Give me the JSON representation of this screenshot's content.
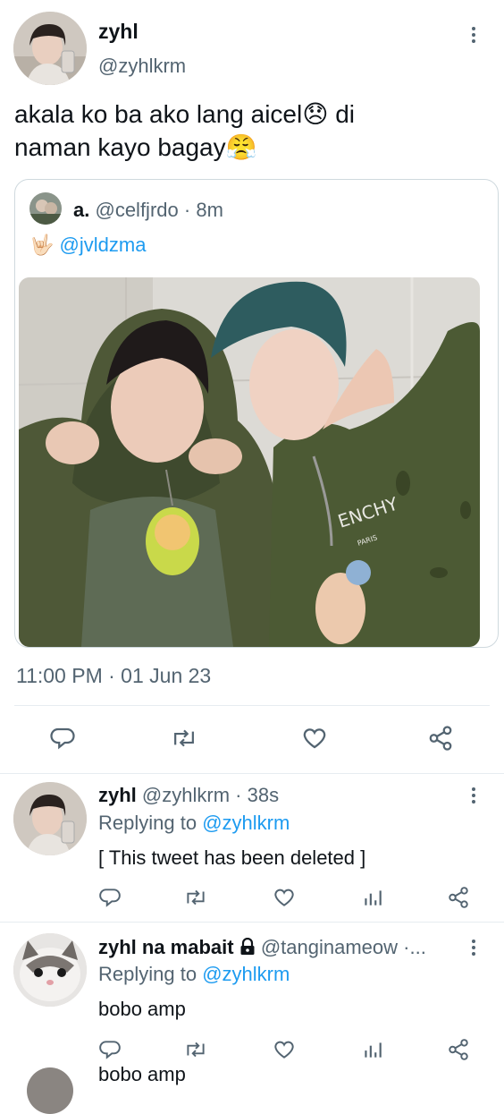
{
  "main_tweet": {
    "display_name": "zyhl",
    "handle": "@zyhlkrm",
    "text_line1": "akala ko ba ako lang aicel😞 di",
    "text_line2": "naman kayo bagay😤",
    "quoted": {
      "display_name": "a.",
      "handle": "@celfjrdo",
      "separator": "·",
      "time": "8m",
      "emoji": "🤟🏻",
      "mention": "@jvldzma"
    },
    "timestamp": "11:00 PM · 01 Jun 23"
  },
  "replies": [
    {
      "display_name": "zyhl",
      "handle": "@zyhlkrm",
      "separator": "·",
      "time": "38s",
      "replying_label": "Replying to",
      "replying_handle": "@zyhlkrm",
      "text": "[ This tweet has been deleted ]"
    },
    {
      "display_name": "zyhl na mabait",
      "handle": "@tanginameow ·...",
      "replying_label": "Replying to",
      "replying_handle": "@zyhlkrm",
      "text": "bobo amp"
    }
  ],
  "partial_next_text": "bobo amp",
  "icons": {
    "reply": "reply-icon",
    "retweet": "retweet-icon",
    "like": "heart-icon",
    "analytics": "analytics-icon",
    "share": "share-icon",
    "lock": "lock-icon",
    "more": "more-icon"
  },
  "colors": {
    "accent": "#1d9bf0",
    "secondary_text": "#536471",
    "text": "#0f1419"
  }
}
